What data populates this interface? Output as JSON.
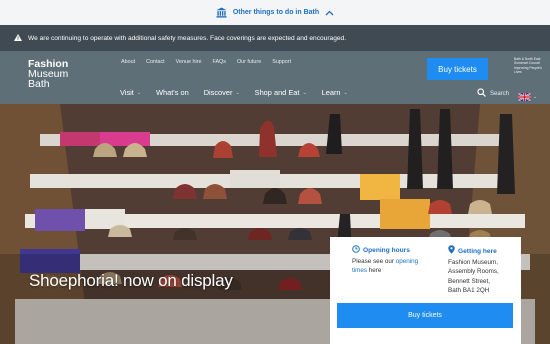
{
  "topbar": {
    "label": "Other things to do in Bath",
    "icon": "museum-building-icon",
    "chevron": "chevron-up-icon"
  },
  "alert": {
    "text": "We are continuing to operate with additional safety measures. Face coverings are expected and encouraged.",
    "icon": "warning-icon"
  },
  "logo": {
    "line1": "Fashion",
    "line2": "Museum",
    "line3": "Bath"
  },
  "utility_nav": [
    "About",
    "Contact",
    "Venue hire",
    "FAQs",
    "Our future",
    "Support"
  ],
  "main_nav": [
    "Visit",
    "What's on",
    "Discover",
    "Shop and Eat",
    "Learn"
  ],
  "header": {
    "tickets_label": "Buy tickets",
    "council_line1": "Bath & North East",
    "council_line2": "Somerset Council",
    "council_line3": "Improving People's Lives",
    "search_label": "Search"
  },
  "hero": {
    "title": "Shoephoria! now on display"
  },
  "card": {
    "hours_title": "Opening hours",
    "hours_text_before": "Please see our ",
    "hours_link": "opening times",
    "hours_text_after": " here",
    "getting_title": "Getting here",
    "address_line1": "Fashion Museum,",
    "address_line2": "Assembly Rooms,",
    "address_line3": "Bennett Street,",
    "address_line4": "Bath BA1 2QH",
    "tickets_label": "Buy tickets"
  },
  "colors": {
    "accent": "#1e8cf0",
    "link": "#1f6fc1",
    "alert_bg": "#3f4a52",
    "header_bg": "#5f6f78"
  }
}
